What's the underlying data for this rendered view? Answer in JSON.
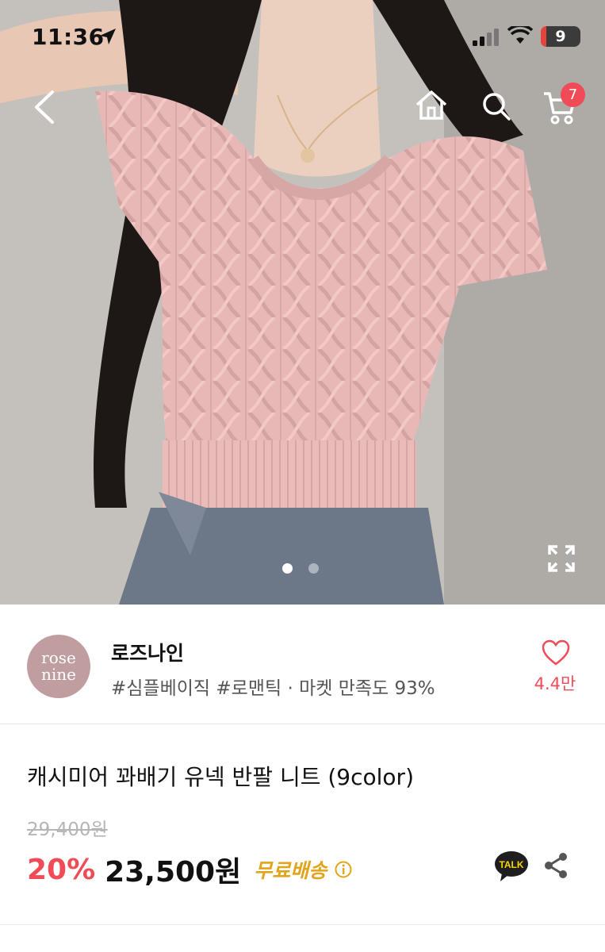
{
  "status_bar": {
    "time": "11:36",
    "battery": "9"
  },
  "nav": {
    "cart_count": "7"
  },
  "gallery": {
    "current_index": 1,
    "total": 2
  },
  "shop": {
    "logo_line1": "rose",
    "logo_line2": "nine",
    "name": "로즈나인",
    "tags": "#심플베이직 #로맨틱 · 마켓 만족도 93%",
    "likes": "4.4만"
  },
  "product": {
    "title": "캐시미어 꽈배기 유넥 반팔 니트 (9color)",
    "original_price": "29,400원",
    "discount": "20%",
    "price": "23,500원",
    "shipping": "무료배송"
  },
  "colors": {
    "accent": "#f04b57",
    "shipping": "#e1a41a",
    "logo_bg": "#c09ea0"
  }
}
